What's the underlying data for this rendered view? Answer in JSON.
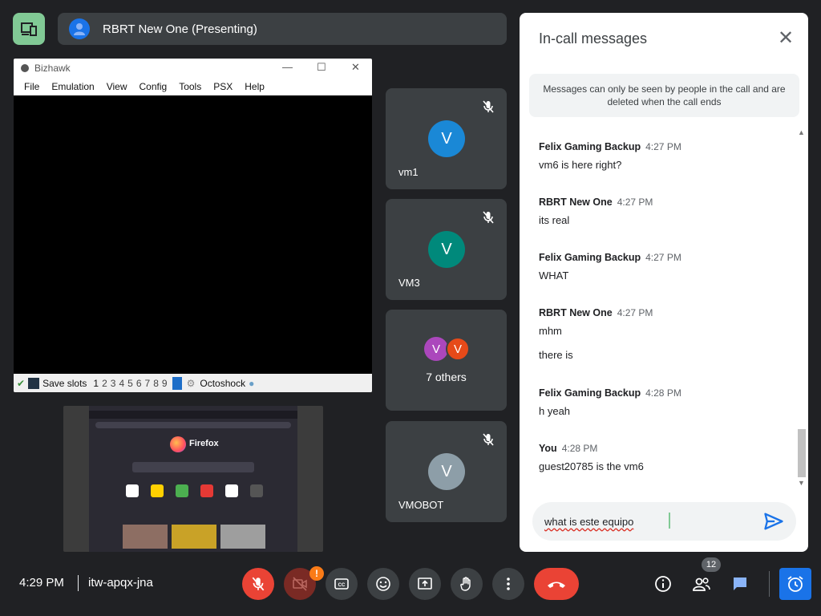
{
  "presenter": {
    "name": "RBRT New One (Presenting)"
  },
  "bizhawk": {
    "title": "Bizhawk",
    "menu": [
      "File",
      "Emulation",
      "View",
      "Config",
      "Tools",
      "PSX",
      "Help"
    ],
    "status": {
      "save_slots_label": "Save slots",
      "slots": [
        "1",
        "2",
        "3",
        "4",
        "5",
        "6",
        "7",
        "8",
        "9"
      ],
      "core": "Octoshock"
    }
  },
  "firefox_preview": {
    "brand": "Firefox"
  },
  "tiles": [
    {
      "initial": "V",
      "name": "vm1",
      "color": "#1a88d6",
      "muted": true
    },
    {
      "initial": "V",
      "name": "VM3",
      "color": "#00897b",
      "muted": true
    },
    {
      "avatars": [
        {
          "initial": "V",
          "color": "#ab47bc"
        },
        {
          "initial": "V",
          "color": "#e64a19"
        }
      ],
      "name": "7 others"
    },
    {
      "initial": "V",
      "name": "VMOBOT",
      "color": "#8d9ea8",
      "muted": true
    }
  ],
  "chat": {
    "title": "In-call messages",
    "notice": "Messages can only be seen by people in the call and are deleted when the call ends",
    "messages": [
      {
        "sender": "Felix Gaming Backup",
        "time": "4:27 PM",
        "lines": [
          "vm6 is here right?"
        ]
      },
      {
        "sender": "RBRT New One",
        "time": "4:27 PM",
        "lines": [
          "its real"
        ]
      },
      {
        "sender": "Felix Gaming Backup",
        "time": "4:27 PM",
        "lines": [
          "WHAT"
        ]
      },
      {
        "sender": "RBRT New One",
        "time": "4:27 PM",
        "lines": [
          "mhm",
          "there is"
        ]
      },
      {
        "sender": "Felix Gaming Backup",
        "time": "4:28 PM",
        "lines": [
          "h yeah"
        ]
      },
      {
        "sender": "You",
        "time": "4:28 PM",
        "lines": [
          "guest20785 is the vm6"
        ]
      }
    ],
    "input_value": "what is este equipo"
  },
  "bottom": {
    "clock": "4:29 PM",
    "meeting_code": "itw-apqx-jna",
    "people_count": "12",
    "camera_alert": "!"
  },
  "colors": {
    "accent": "#8ab4f8",
    "danger": "#ea4335",
    "green": "#81c995",
    "host_blue": "#1a73e8"
  }
}
